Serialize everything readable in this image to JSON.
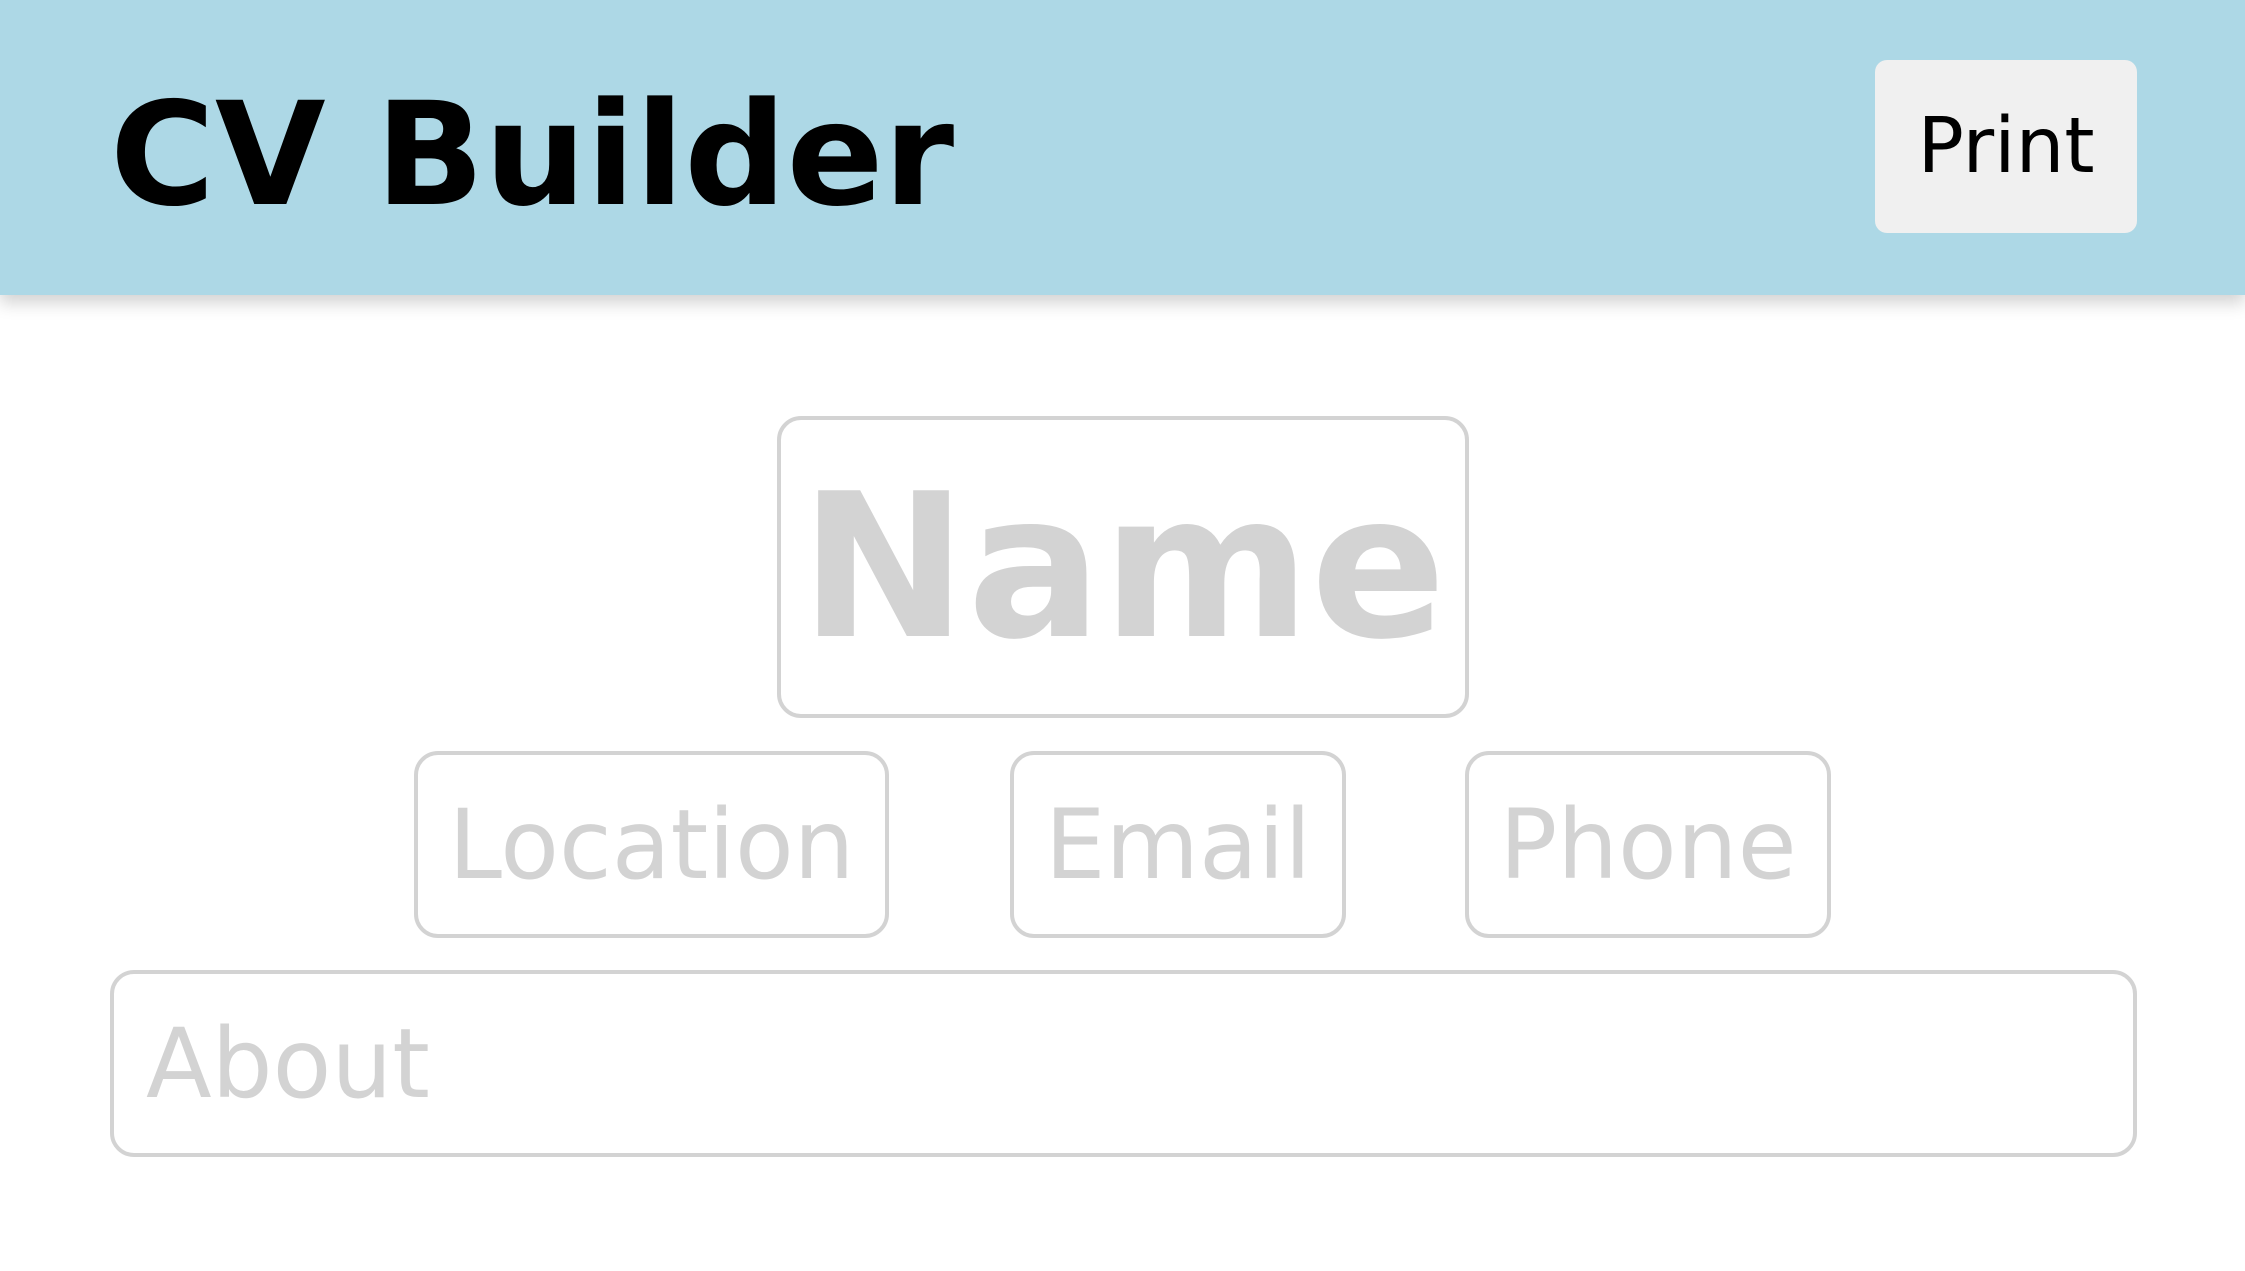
{
  "header": {
    "title": "CV Builder",
    "print_label": "Print",
    "background_color": "#add8e6"
  },
  "cv": {
    "name_placeholder": "Name",
    "location_placeholder": "Location",
    "email_placeholder": "Email",
    "phone_placeholder": "Phone",
    "about_placeholder": "About",
    "placeholder_color": "#d3d3d3"
  }
}
